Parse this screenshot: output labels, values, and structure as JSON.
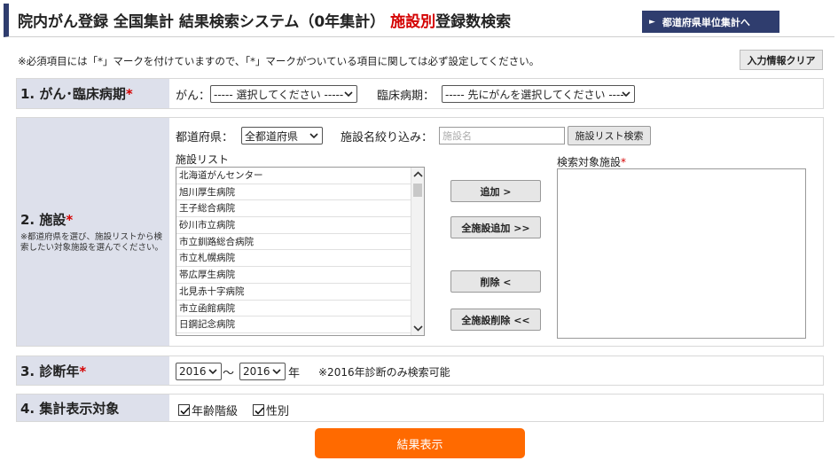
{
  "header": {
    "title_prefix": "院内がん登録 全国集計 結果検索システム（0年集計）",
    "title_red": "施設別",
    "title_suffix": "登録数検索",
    "pref_button": "都道府県単位集計へ"
  },
  "note": "※必須項目には「*」マークを付けていますので、「*」マークがついている項目に関しては必ず設定してください。",
  "clear_button": "入力情報クリア",
  "section1": {
    "label": "1.  がん･臨床病期",
    "cancer_label": "がん：",
    "cancer_select": "----- 選択してください -----",
    "stage_label": "臨床病期：",
    "stage_select": "----- 先にがんを選択してください -----"
  },
  "section2": {
    "label": "2.  施設",
    "sub": "※都道府県を選び、施設リストから検索したい対象施設を選んでください。",
    "pref_label": "都道府県：",
    "pref_select": "全都道府県",
    "filter_label": "施設名絞り込み：",
    "filter_placeholder": "施設名",
    "list_search_button": "施設リスト検索",
    "list_label": "施設リスト",
    "facilities": [
      "北海道がんセンター",
      "旭川厚生病院",
      "王子総合病院",
      "砂川市立病院",
      "市立釧路総合病院",
      "市立札幌病院",
      "帯広厚生病院",
      "北見赤十字病院",
      "市立函館病院",
      "日鋼記念病院"
    ],
    "add_button": "追加 >",
    "add_all_button": "全施設追加 >>",
    "remove_button": "削除 <",
    "remove_all_button": "全施設削除 <<",
    "target_label": "検索対象施設"
  },
  "section3": {
    "label": "3.  診断年",
    "from_year": "2016",
    "tilde": "～",
    "to_year": "2016",
    "year_unit": "年",
    "note": "※2016年診断のみ検索可能"
  },
  "section4": {
    "label": "4.  集計表示対象",
    "age_label": "年齢階級",
    "sex_label": "性別"
  },
  "submit_button": "結果表示",
  "required_mark": "*"
}
